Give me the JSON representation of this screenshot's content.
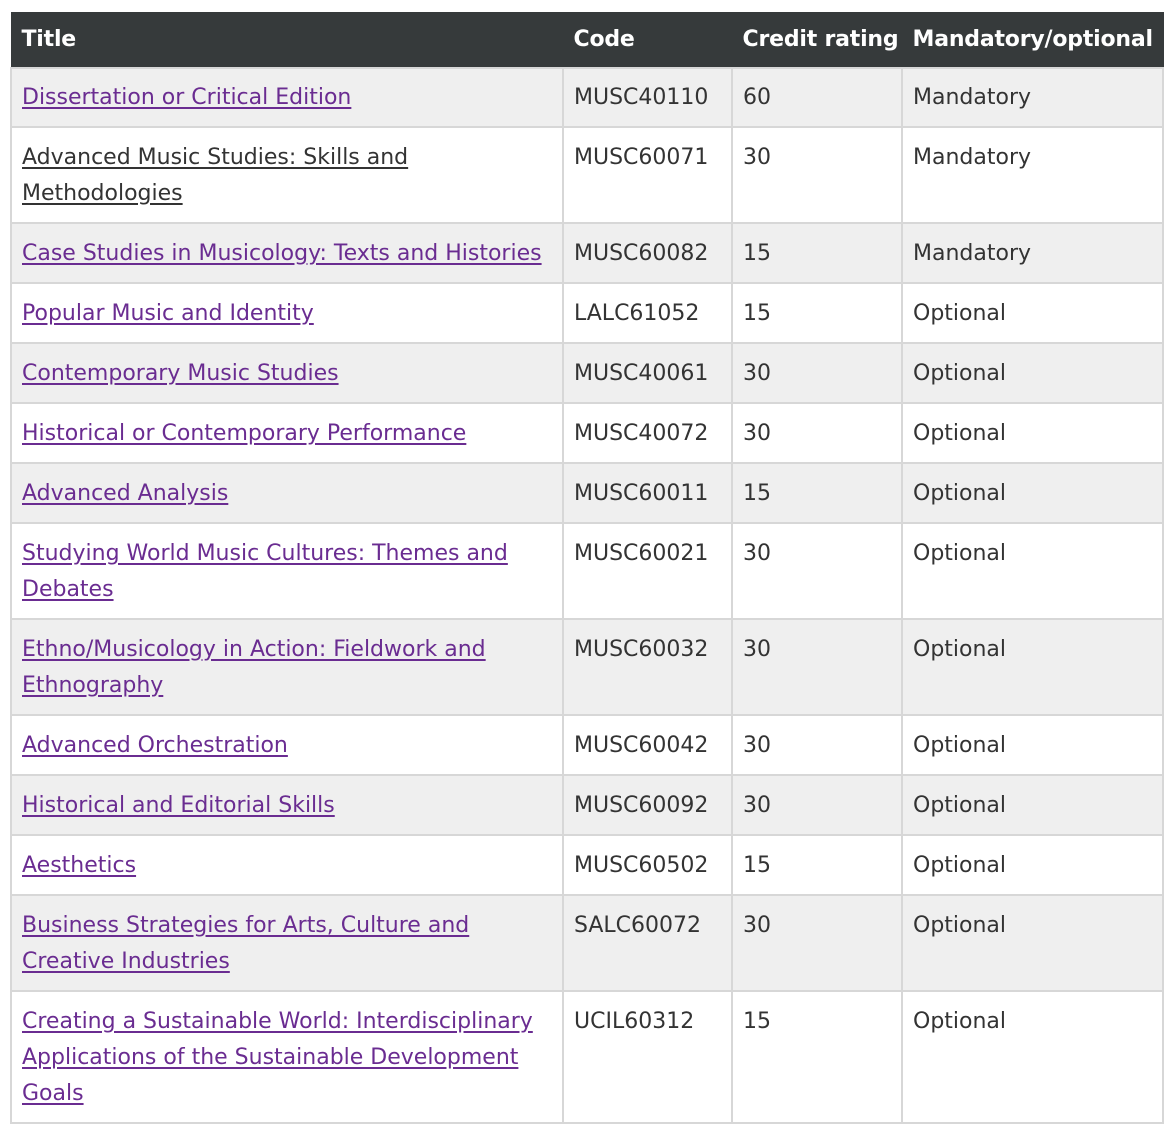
{
  "table": {
    "headers": {
      "title": "Title",
      "code": "Code",
      "credit": "Credit rating",
      "mandatory": "Mandatory/optional"
    },
    "rows": [
      {
        "title": "Dissertation or Critical Edition",
        "code": "MUSC40110",
        "credit": "60",
        "status": "Mandatory"
      },
      {
        "title": "Advanced Music Studies: Skills and Methodologies",
        "code": "MUSC60071",
        "credit": "30",
        "status": "Mandatory"
      },
      {
        "title": "Case Studies in Musicology: Texts and Histories",
        "code": "MUSC60082",
        "credit": "15",
        "status": "Mandatory"
      },
      {
        "title": "Popular Music and Identity",
        "code": "LALC61052",
        "credit": "15",
        "status": "Optional"
      },
      {
        "title": "Contemporary Music Studies",
        "code": "MUSC40061",
        "credit": "30",
        "status": "Optional"
      },
      {
        "title": "Historical or Contemporary Performance",
        "code": "MUSC40072",
        "credit": "30",
        "status": "Optional"
      },
      {
        "title": "Advanced Analysis",
        "code": "MUSC60011",
        "credit": "15",
        "status": "Optional"
      },
      {
        "title": "Studying World Music Cultures: Themes and Debates",
        "code": "MUSC60021",
        "credit": "30",
        "status": "Optional"
      },
      {
        "title": "Ethno/Musicology in Action: Fieldwork and Ethnography",
        "code": "MUSC60032",
        "credit": "30",
        "status": "Optional"
      },
      {
        "title": "Advanced Orchestration",
        "code": "MUSC60042",
        "credit": "30",
        "status": "Optional"
      },
      {
        "title": "Historical and Editorial Skills",
        "code": "MUSC60092",
        "credit": "30",
        "status": "Optional"
      },
      {
        "title": "Aesthetics",
        "code": "MUSC60502",
        "credit": "15",
        "status": "Optional"
      },
      {
        "title": "Business Strategies for Arts, Culture and Creative Industries",
        "code": "SALC60072",
        "credit": "30",
        "status": "Optional"
      },
      {
        "title": "Creating a Sustainable World: Interdisciplinary Applications of the Sustainable Development Goals",
        "code": "UCIL60312",
        "credit": "15",
        "status": "Optional"
      }
    ]
  },
  "colors": {
    "header_bg": "#363a3b",
    "link": "#6a2c91",
    "visited_link": "#333333",
    "row_alt_bg": "#efefef",
    "border": "#d7d7d7"
  }
}
